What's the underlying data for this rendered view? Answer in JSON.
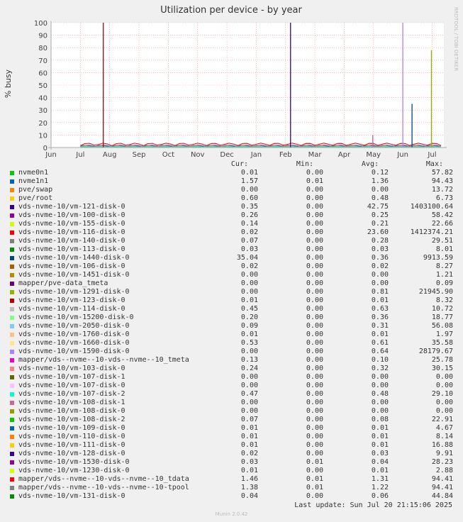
{
  "title": "Utilization per device - by year",
  "ylabel": "% busy",
  "watermark": "RRDTOOL / TOBI OETIKER",
  "last_update": "Last update:  Sun Jul 20 21:15:06 2025",
  "footer": "Munin 2.0.42",
  "legend_headers": {
    "cur": "Cur:",
    "min": "Min:",
    "avg": "Avg:",
    "max": "Max:"
  },
  "chart_data": {
    "type": "line",
    "title": "Utilization per device - by year",
    "ylabel": "% busy",
    "ylim": [
      0,
      100
    ],
    "yticks": [
      0,
      10,
      20,
      30,
      40,
      50,
      60,
      70,
      80,
      90,
      100
    ],
    "xticks": [
      "Jun",
      "Jul",
      "Aug",
      "Sep",
      "Oct",
      "Nov",
      "Dec",
      "Jan",
      "Feb",
      "Mar",
      "Apr",
      "May",
      "Jun",
      "Jul"
    ],
    "grid": true,
    "series": [
      {
        "name": "nvme0n1",
        "color": "#00cc00",
        "cur": "0.01",
        "min": "0.00",
        "avg": "0.12",
        "max": "57.82"
      },
      {
        "name": "nvme1n1",
        "color": "#0066b3",
        "cur": "1.57",
        "min": "0.01",
        "avg": "1.36",
        "max": "94.43"
      },
      {
        "name": "pve/swap",
        "color": "#ff8000",
        "cur": "0.00",
        "min": "0.00",
        "avg": "0.00",
        "max": "13.72"
      },
      {
        "name": "pve/root",
        "color": "#ffcc00",
        "cur": "0.60",
        "min": "0.00",
        "avg": "0.48",
        "max": "6.73"
      },
      {
        "name": "vds-nvme-10/vm-121-disk-0",
        "color": "#330099",
        "cur": "0.35",
        "min": "0.00",
        "avg": "42.75",
        "max": "1403100.64"
      },
      {
        "name": "vds-nvme-10/vm-100-disk-0",
        "color": "#990099",
        "cur": "0.26",
        "min": "0.00",
        "avg": "0.25",
        "max": "58.42"
      },
      {
        "name": "vds-nvme-10/vm-155-disk-0",
        "color": "#ccff00",
        "cur": "0.14",
        "min": "0.00",
        "avg": "0.21",
        "max": "22.66"
      },
      {
        "name": "vds-nvme-10/vm-116-disk-0",
        "color": "#ff0000",
        "cur": "0.02",
        "min": "0.00",
        "avg": "23.60",
        "max": "1412374.21"
      },
      {
        "name": "vds-nvme-10/vm-140-disk-0",
        "color": "#808080",
        "cur": "0.07",
        "min": "0.00",
        "avg": "0.28",
        "max": "29.51"
      },
      {
        "name": "vds-nvme-10/vm-113-disk-0",
        "color": "#008f00",
        "cur": "0.03",
        "min": "0.00",
        "avg": "0.03",
        "max": "8.01"
      },
      {
        "name": "vds-nvme-10/vm-1440-disk-0",
        "color": "#00487d",
        "cur": "35.04",
        "min": "0.00",
        "avg": "0.36",
        "max": "9913.59"
      },
      {
        "name": "vds-nvme-10/vm-106-disk-0",
        "color": "#b35a00",
        "cur": "0.02",
        "min": "0.00",
        "avg": "0.02",
        "max": "8.27"
      },
      {
        "name": "vds-nvme-10/vm-1451-disk-0",
        "color": "#b38f00",
        "cur": "0.00",
        "min": "0.00",
        "avg": "0.00",
        "max": "1.21"
      },
      {
        "name": "mapper/pve-data_tmeta",
        "color": "#6b006b",
        "cur": "0.00",
        "min": "0.00",
        "avg": "0.00",
        "max": "0.09"
      },
      {
        "name": "vds-nvme-10/vm-1291-disk-0",
        "color": "#8fb300",
        "cur": "0.00",
        "min": "0.00",
        "avg": "0.81",
        "max": "21945.90"
      },
      {
        "name": "vds-nvme-10/vm-123-disk-0",
        "color": "#b30000",
        "cur": "0.01",
        "min": "0.00",
        "avg": "0.01",
        "max": "8.32"
      },
      {
        "name": "vds-nvme-10/vm-114-disk-0",
        "color": "#bebebe",
        "cur": "0.45",
        "min": "0.00",
        "avg": "0.63",
        "max": "10.72"
      },
      {
        "name": "vds-nvme-10/vm-15200-disk-0",
        "color": "#80ff80",
        "cur": "0.20",
        "min": "0.00",
        "avg": "0.36",
        "max": "18.77"
      },
      {
        "name": "vds-nvme-10/vm-2050-disk-0",
        "color": "#80c9ff",
        "cur": "0.09",
        "min": "0.00",
        "avg": "0.31",
        "max": "56.08"
      },
      {
        "name": "vds-nvme-10/vm-1760-disk-0",
        "color": "#ffc080",
        "cur": "0.01",
        "min": "0.00",
        "avg": "0.01",
        "max": "1.97"
      },
      {
        "name": "vds-nvme-10/vm-1660-disk-0",
        "color": "#ffe680",
        "cur": "0.53",
        "min": "0.00",
        "avg": "0.61",
        "max": "35.58"
      },
      {
        "name": "vds-nvme-10/vm-1590-disk-0",
        "color": "#aa80ff",
        "cur": "0.00",
        "min": "0.00",
        "avg": "0.64",
        "max": "28179.67"
      },
      {
        "name": "mapper/vds--nvme--10-vds--nvme--10_tmeta",
        "color": "#ee00cc",
        "cur": "0.13",
        "min": "0.00",
        "avg": "0.10",
        "max": "25.78"
      },
      {
        "name": "vds-nvme-10/vm-103-disk-0",
        "color": "#ff8080",
        "cur": "0.24",
        "min": "0.00",
        "avg": "0.32",
        "max": "30.15"
      },
      {
        "name": "vds-nvme-10/vm-107-disk-1",
        "color": "#666600",
        "cur": "0.00",
        "min": "0.00",
        "avg": "0.00",
        "max": "0.00"
      },
      {
        "name": "vds-nvme-10/vm-107-disk-0",
        "color": "#ffbfff",
        "cur": "0.00",
        "min": "0.00",
        "avg": "0.00",
        "max": "0.00"
      },
      {
        "name": "vds-nvme-10/vm-107-disk-2",
        "color": "#00ffcc",
        "cur": "0.47",
        "min": "0.00",
        "avg": "0.48",
        "max": "29.10"
      },
      {
        "name": "vds-nvme-10/vm-108-disk-1",
        "color": "#cc6699",
        "cur": "0.00",
        "min": "0.00",
        "avg": "0.00",
        "max": "0.00"
      },
      {
        "name": "vds-nvme-10/vm-108-disk-0",
        "color": "#999900",
        "cur": "0.00",
        "min": "0.00",
        "avg": "0.00",
        "max": "0.00"
      },
      {
        "name": "vds-nvme-10/vm-108-disk-2",
        "color": "#00cc00",
        "cur": "0.07",
        "min": "0.00",
        "avg": "0.08",
        "max": "22.91"
      },
      {
        "name": "vds-nvme-10/vm-109-disk-0",
        "color": "#0066b3",
        "cur": "0.01",
        "min": "0.00",
        "avg": "0.01",
        "max": "4.67"
      },
      {
        "name": "vds-nvme-10/vm-110-disk-0",
        "color": "#ff8000",
        "cur": "0.01",
        "min": "0.00",
        "avg": "0.01",
        "max": "8.14"
      },
      {
        "name": "vds-nvme-10/vm-111-disk-0",
        "color": "#ffcc00",
        "cur": "0.01",
        "min": "0.00",
        "avg": "0.01",
        "max": "16.88"
      },
      {
        "name": "vds-nvme-10/vm-128-disk-0",
        "color": "#330099",
        "cur": "0.02",
        "min": "0.00",
        "avg": "0.03",
        "max": "9.91"
      },
      {
        "name": "vds-nvme-10/vm-1530-disk-0",
        "color": "#990099",
        "cur": "0.03",
        "min": "0.01",
        "avg": "0.04",
        "max": "28.23"
      },
      {
        "name": "vds-nvme-10/vm-1230-disk-0",
        "color": "#ccff00",
        "cur": "0.01",
        "min": "0.00",
        "avg": "0.01",
        "max": "2.88"
      },
      {
        "name": "mapper/vds--nvme--10-vds--nvme--10_tdata",
        "color": "#ff0000",
        "cur": "1.46",
        "min": "0.01",
        "avg": "1.31",
        "max": "94.41"
      },
      {
        "name": "mapper/vds--nvme--10-vds--nvme--10-tpool",
        "color": "#808080",
        "cur": "1.38",
        "min": "0.01",
        "avg": "1.22",
        "max": "94.41"
      },
      {
        "name": "vds-nvme-10/vm-131-disk-0",
        "color": "#008f00",
        "cur": "0.04",
        "min": "0.00",
        "avg": "0.06",
        "max": "44.84"
      }
    ],
    "spikes": [
      {
        "series": "vds-nvme-10/vm-116-disk-0",
        "color": "#b30000",
        "month": "Aug",
        "value": 100
      },
      {
        "series": "vds-nvme-10/vm-121-disk-0",
        "color": "#330099",
        "month": "Feb",
        "value": 100
      },
      {
        "series": "vds-nvme-10/vm-1590-disk-0",
        "color": "#aa80ff",
        "month": "Jun",
        "value": 100
      },
      {
        "series": "vds-nvme-10/vm-1440-disk-0",
        "color": "#00487d",
        "month": "Jun",
        "value": 35
      },
      {
        "series": "vds-nvme-10/vm-1291-disk-0",
        "color": "#8fb300",
        "month": "Jul",
        "value": 78
      },
      {
        "series": "vds-nvme-10/vm-103-disk-0",
        "color": "#cc6699",
        "month": "May",
        "value": 10
      }
    ]
  }
}
